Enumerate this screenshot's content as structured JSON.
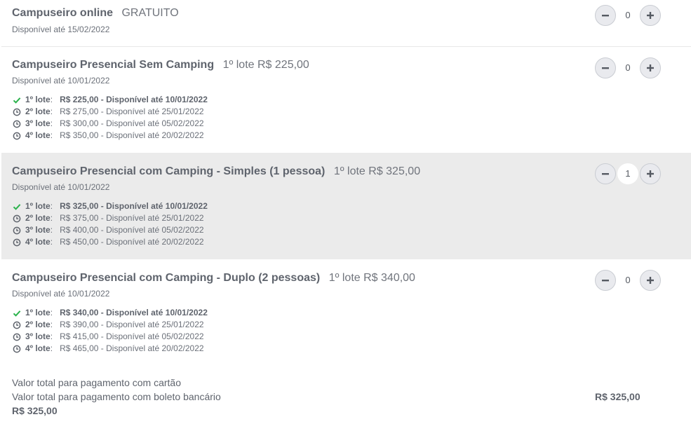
{
  "tickets": [
    {
      "name": "Campuseiro online",
      "price": "GRATUITO",
      "available": "Disponível até 15/02/2022",
      "quantity": "0",
      "selected": false,
      "lots": []
    },
    {
      "name": "Campuseiro Presencial Sem Camping",
      "price": "1º lote R$ 225,00",
      "available": "Disponível até 10/01/2022",
      "quantity": "0",
      "selected": false,
      "lots": [
        {
          "label": "1º lote",
          "detail": "R$ 225,00 - Disponível até 10/01/2022",
          "status": "current",
          "icon": "check-icon"
        },
        {
          "label": "2º lote",
          "detail": "R$ 275,00 - Disponível até 25/01/2022",
          "status": "upcoming",
          "icon": "clock-icon"
        },
        {
          "label": "3º lote",
          "detail": "R$ 300,00 - Disponível até 05/02/2022",
          "status": "upcoming",
          "icon": "clock-icon"
        },
        {
          "label": "4º lote",
          "detail": "R$ 350,00 - Disponível até 20/02/2022",
          "status": "upcoming",
          "icon": "clock-icon"
        }
      ]
    },
    {
      "name": "Campuseiro Presencial com Camping - Simples (1 pessoa)",
      "price": "1º lote R$ 325,00",
      "available": "Disponível até 10/01/2022",
      "quantity": "1",
      "selected": true,
      "lots": [
        {
          "label": "1º lote",
          "detail": "R$ 325,00 - Disponível até 10/01/2022",
          "status": "current",
          "icon": "check-icon"
        },
        {
          "label": "2º lote",
          "detail": "R$ 375,00 - Disponível até 25/01/2022",
          "status": "upcoming",
          "icon": "clock-icon"
        },
        {
          "label": "3º lote",
          "detail": "R$ 400,00 - Disponível até 05/02/2022",
          "status": "upcoming",
          "icon": "clock-icon"
        },
        {
          "label": "4º lote",
          "detail": "R$ 450,00 - Disponível até 20/02/2022",
          "status": "upcoming",
          "icon": "clock-icon"
        }
      ]
    },
    {
      "name": "Campuseiro Presencial com Camping - Duplo (2 pessoas)",
      "price": "1º lote R$ 340,00",
      "available": "Disponível até 10/01/2022",
      "quantity": "0",
      "selected": false,
      "lots": [
        {
          "label": "1º lote",
          "detail": "R$ 340,00 - Disponível até 10/01/2022",
          "status": "current",
          "icon": "check-icon"
        },
        {
          "label": "2º lote",
          "detail": "R$ 390,00 - Disponível até 25/01/2022",
          "status": "upcoming",
          "icon": "clock-icon"
        },
        {
          "label": "3º lote",
          "detail": "R$ 415,00 - Disponível até 05/02/2022",
          "status": "upcoming",
          "icon": "clock-icon"
        },
        {
          "label": "4º lote",
          "detail": "R$ 465,00 - Disponível até 20/02/2022",
          "status": "upcoming",
          "icon": "clock-icon"
        }
      ]
    }
  ],
  "totals": {
    "card_label": "Valor total para pagamento com cartão",
    "boleto_label": "Valor total para pagamento com boleto bancário",
    "card_amount": "R$ 325,00",
    "boleto_amount": "R$ 325,00"
  },
  "colors": {
    "check": "#2bb24c",
    "clock": "#5f646d",
    "selected_bg": "#ebebeb"
  }
}
